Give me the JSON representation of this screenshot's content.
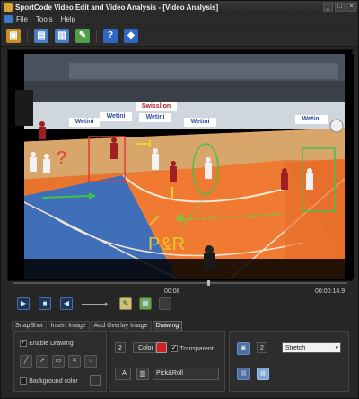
{
  "window": {
    "title": "SportCode Video Edit and Video Analysis - [Video Analysis]",
    "controls": [
      "_",
      "□",
      "×"
    ]
  },
  "menu": {
    "items": [
      "File",
      "Tools",
      "Help"
    ]
  },
  "toolbar": {
    "buttons": [
      {
        "name": "open-icon",
        "glyph": "▣",
        "color": "#c98d2e"
      },
      {
        "name": "film-icon",
        "glyph": "▤",
        "color": "#4a7ec4"
      },
      {
        "name": "film-strip-icon",
        "glyph": "▥",
        "color": "#4a7ec4"
      },
      {
        "name": "edit-icon",
        "glyph": "✎",
        "color": "#4f9e4a"
      },
      {
        "name": "help-icon",
        "glyph": "?",
        "color": "#2f67c2"
      },
      {
        "name": "settings-icon",
        "glyph": "◆",
        "color": "#2f67c2"
      }
    ]
  },
  "video": {
    "banners": [
      "Swisslion",
      "Wetini",
      "Wetini",
      "Wetini",
      "Wetini",
      "Wetini"
    ],
    "annotation_text": "P&R"
  },
  "transport": {
    "current_time": "00:08",
    "total_time": "00:00:14.9"
  },
  "tabs": {
    "items": [
      "SnapShot",
      "Insert Image",
      "Add Overlay Image",
      "Drawing"
    ],
    "active": "Drawing"
  },
  "drawing": {
    "enable_label": "Enable Drawing",
    "background_label": "Background color",
    "width_value": "2",
    "color_label": "Color",
    "color_value": "#d61f1f",
    "transparent_label": "Transparent",
    "font_label": "A",
    "text_value": "Pick&Roll",
    "image_width_value": "2",
    "mode_value": "Stretch"
  }
}
